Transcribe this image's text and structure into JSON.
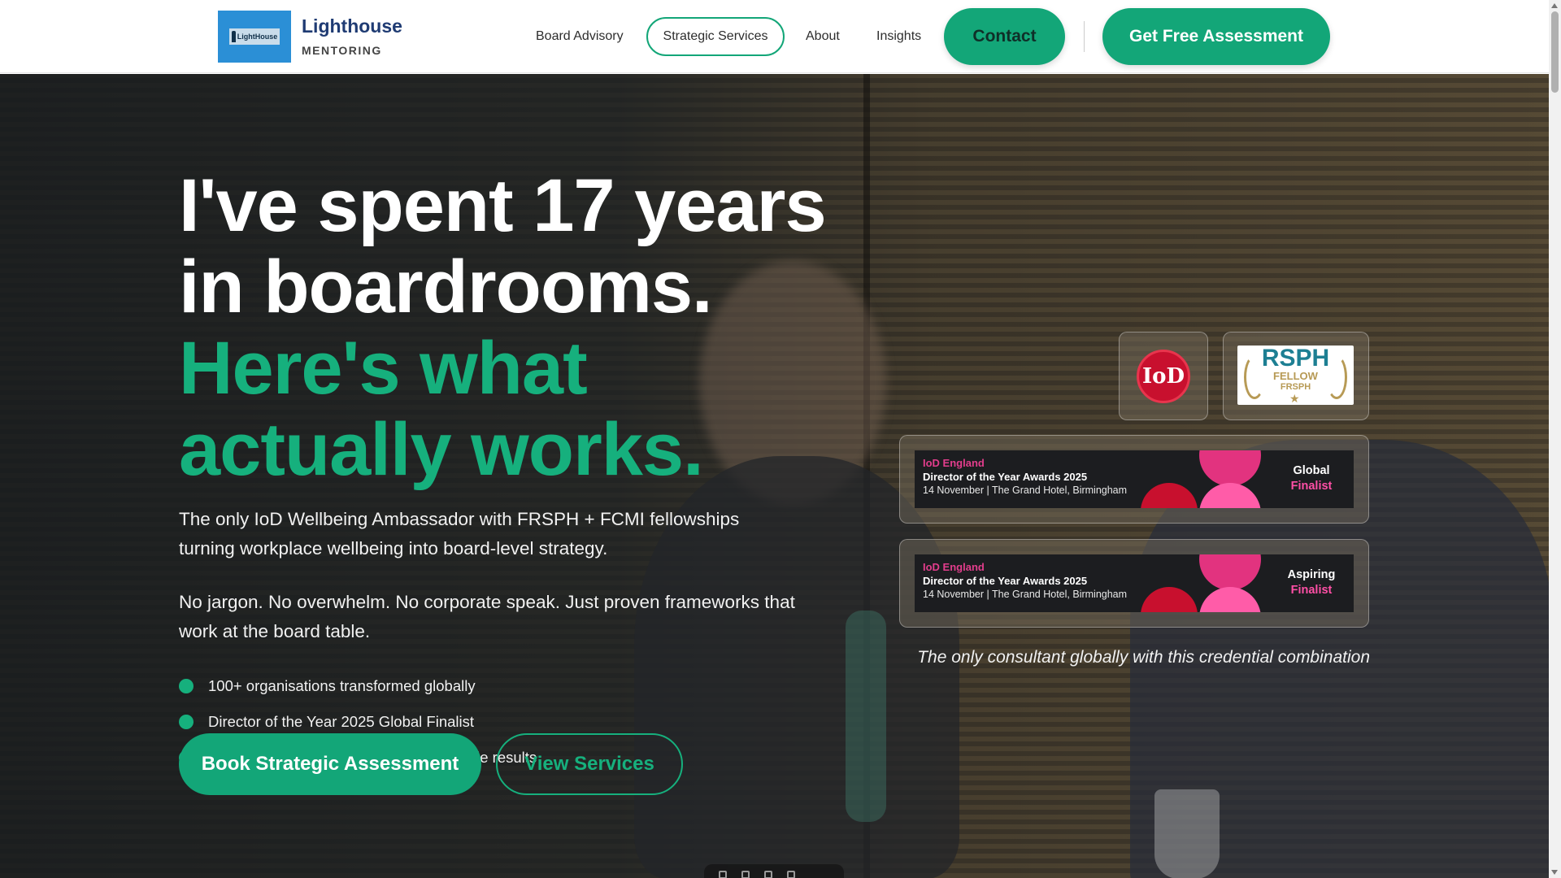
{
  "brand": {
    "logo_text": "LightHouse",
    "name": "Lighthouse",
    "tagline": "MENTORING"
  },
  "nav": {
    "links": [
      {
        "label": "Board Advisory"
      },
      {
        "label": "Strategic Services"
      },
      {
        "label": "About"
      },
      {
        "label": "Insights"
      }
    ],
    "contact_label": "Contact",
    "cta_label": "Get Free Assessment"
  },
  "hero": {
    "headline_lines": [
      "I've spent 17 years",
      "in boardrooms."
    ],
    "headline_accent_lines": [
      "Here's what",
      "actually works."
    ],
    "lead_1": "The only IoD Wellbeing Ambassador with FRSPH + FCMI fellowships turning workplace wellbeing into board-level strategy.",
    "lead_2": "No jargon. No overwhelm. No corporate speak. Just proven frameworks that work at the board table.",
    "bullets": [
      "100+ organisations transformed globally",
      "Director of the Year 2025 Global Finalist",
      "AI-enhanced methodology for measurable results"
    ],
    "primary_cta": "Book Strategic Assessment",
    "secondary_cta": "View Services"
  },
  "credentials": {
    "iod_seal_text": "IoD",
    "rsph_title": "RSPH",
    "rsph_fellow": "FELLOW",
    "rsph_sub": "FRSPH",
    "awards": [
      {
        "org": "IoD England",
        "title": "Director of the Year Awards 2025",
        "meta": "14 November  |  The Grand Hotel, Birmingham",
        "level": "Global",
        "level_sub": "Finalist"
      },
      {
        "org": "IoD England",
        "title": "Director of the Year Awards 2025",
        "meta": "14 November  |  The Grand Hotel, Birmingham",
        "level": "Aspiring",
        "level_sub": "Finalist"
      }
    ],
    "note": "The only consultant globally with this credential combination"
  },
  "colors": {
    "accent": "#13a678",
    "brand_navy": "#1f3b73",
    "award_pink": "#e23d8c",
    "iod_red": "#c8102e",
    "rsph_teal": "#1d7f93",
    "rsph_gold": "#b79a55"
  },
  "icons": [
    "lighthouse-logo-icon",
    "bullet-dot-icon",
    "scroll-up-icon",
    "scroll-down-icon",
    "iod-seal-icon",
    "rsph-laurel-icon"
  ]
}
